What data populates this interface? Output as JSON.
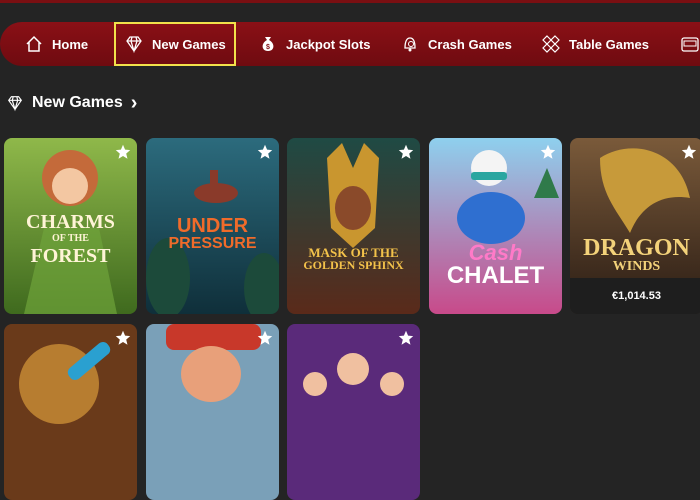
{
  "nav": {
    "items": [
      {
        "label": "Home",
        "icon": "home-icon"
      },
      {
        "label": "New Games",
        "icon": "diamond-icon"
      },
      {
        "label": "Jackpot Slots",
        "icon": "money-bag-icon"
      },
      {
        "label": "Crash Games",
        "icon": "bell-coin-icon"
      },
      {
        "label": "Table Games",
        "icon": "dice-icon"
      }
    ]
  },
  "section": {
    "title": "New Games",
    "chevron": "›"
  },
  "games": [
    {
      "title_line1": "CHARMS",
      "title_line2": "OF THE",
      "title_line3": "FOREST"
    },
    {
      "title_line1": "UNDER",
      "title_line2": "PRESSURE"
    },
    {
      "title_line1": "MASK OF THE",
      "title_line2": "GOLDEN SPHINX"
    },
    {
      "title_line1": "Cash",
      "title_line2": "CHALET"
    },
    {
      "title_line1": "DRAGON",
      "title_line2": "WINDS",
      "jackpot": "€1,014.53"
    }
  ],
  "colors": {
    "nav_bg": "#7f0d13",
    "active_outline": "#f2e14b",
    "page_bg": "#242424"
  }
}
